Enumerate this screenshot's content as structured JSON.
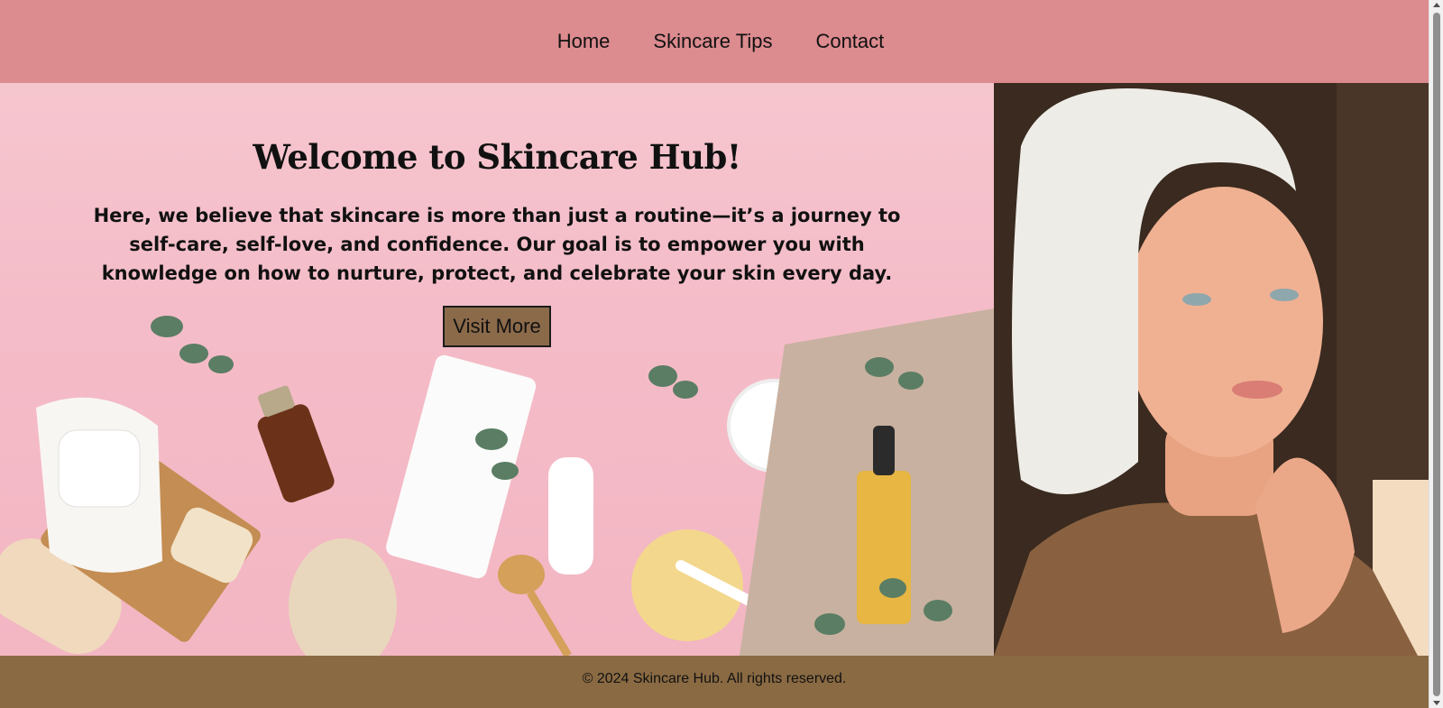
{
  "nav": {
    "items": [
      {
        "label": "Home"
      },
      {
        "label": "Skincare Tips"
      },
      {
        "label": "Contact"
      }
    ]
  },
  "hero": {
    "title": "Welcome to Skincare Hub!",
    "text": "Here, we believe that skincare is more than just a routine—it’s a journey to self-care, self-love, and confidence. Our goal is to empower you with knowledge on how to nurture, protect, and celebrate your skin every day.",
    "button_label": "Visit More"
  },
  "footer": {
    "text": "© 2024 Skincare Hub. All rights reserved."
  },
  "colors": {
    "nav_background": "#dc8b8f",
    "hero_background": "#f4bcc8",
    "button_background": "#8b6a4a",
    "footer_background": "#8a6a43"
  },
  "images": {
    "hero_background": "flat-lay-skincare-products",
    "portrait": "woman-with-towel-portrait"
  }
}
